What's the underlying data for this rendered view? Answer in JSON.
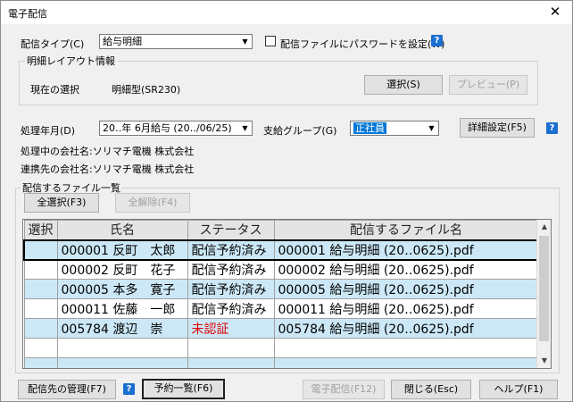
{
  "window": {
    "title": "電子配信",
    "close": "✕"
  },
  "delivery_type": {
    "label": "配信タイプ(C)",
    "value": "給与明細"
  },
  "password_setting": {
    "label": "配信ファイルにパスワードを設定(W)",
    "checked": false
  },
  "layout_info": {
    "group_title": "明細レイアウト情報",
    "current_label": "現在の選択",
    "current_value": "明細型(SR230)",
    "select_button": "選択(S)",
    "preview_button": "プレビュー(P)"
  },
  "processing_month": {
    "label": "処理年月(D)",
    "value": "20‥年 6月給与 (20‥/06/25)"
  },
  "payment_group": {
    "label": "支給グループ(G)",
    "value": "正社員"
  },
  "detail_settings_button": "詳細設定(F5)",
  "company": {
    "processing_label": "処理中の会社名:ソリマチ電機 株式会社",
    "linked_label": "連携先の会社名:ソリマチ電機 株式会社"
  },
  "file_list": {
    "group_title": "配信するファイル一覧",
    "select_all_button": "全選択(F3)",
    "deselect_all_button": "全解除(F4)",
    "columns": [
      "選択",
      "氏名",
      "ステータス",
      "配信するファイル名"
    ],
    "rows": [
      {
        "name": "000001 反町　太郎",
        "status": "配信予約済み",
        "file": "000001 給与明細 (20‥0625).pdf",
        "status_color": "normal"
      },
      {
        "name": "000002 反町　花子",
        "status": "配信予約済み",
        "file": "000002 給与明細 (20‥0625).pdf",
        "status_color": "normal"
      },
      {
        "name": "000005 本多　寛子",
        "status": "配信予約済み",
        "file": "000005 給与明細 (20‥0625).pdf",
        "status_color": "normal"
      },
      {
        "name": "000011 佐藤　一郎",
        "status": "配信予約済み",
        "file": "000011 給与明細 (20‥0625).pdf",
        "status_color": "normal"
      },
      {
        "name": "005784 渡辺　崇",
        "status": "未認証",
        "file": "005784 給与明細 (20‥0625).pdf",
        "status_color": "#e00000"
      }
    ]
  },
  "bottom": {
    "manage_recipients_button": "配信先の管理(F7)",
    "reservation_list_button": "予約一覧(F6)",
    "send_button": "電子配信(F12)",
    "close_button": "閉じる(Esc)",
    "help_button": "ヘルプ(F1)"
  },
  "help_icon_text": "?"
}
